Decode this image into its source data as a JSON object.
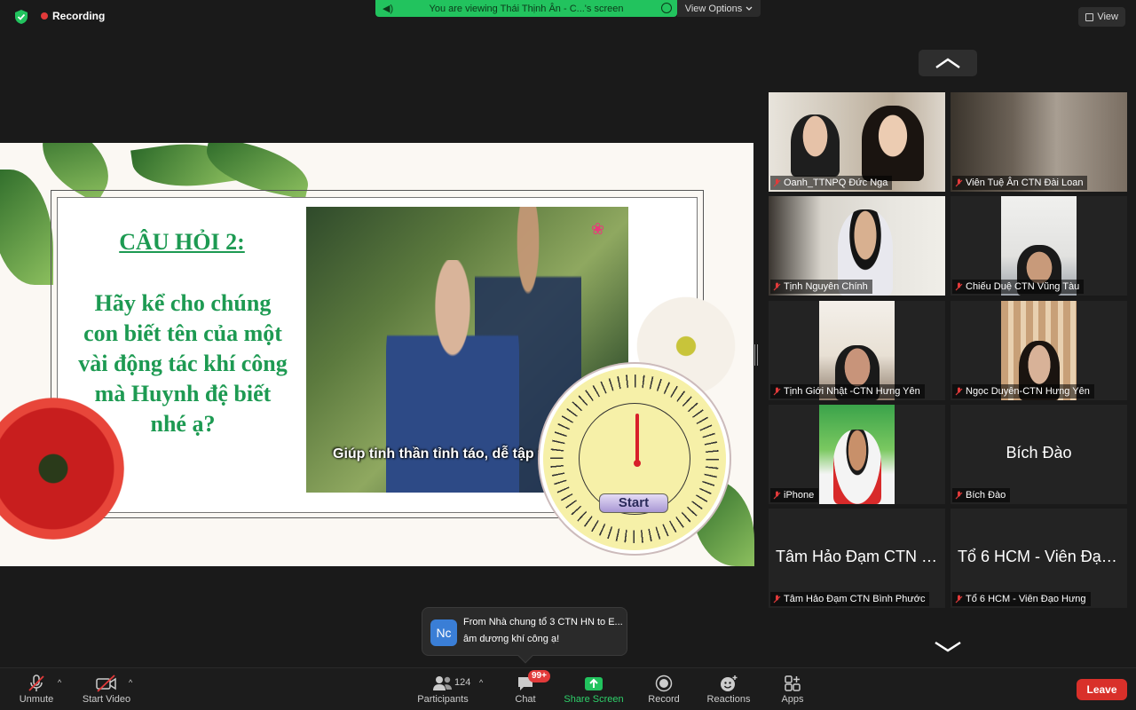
{
  "top": {
    "recording_label": "Recording",
    "viewing_banner": "You are viewing Thái Thịnh Ân - C...'s screen",
    "view_options_label": "View Options",
    "view_label": "View"
  },
  "slide": {
    "question_title": "CÂU HỎI 2:",
    "question_lines": [
      "Hãy kể cho chúng",
      "con biết tên của một",
      "vài động tác khí công",
      "mà Huynh đệ biết",
      "nhé ạ?"
    ],
    "video_subtitle": "Giúp tinh thần tỉnh táo, dễ tập trung, b",
    "start_button_label": "Start"
  },
  "gallery": {
    "tiles": [
      {
        "name": "Oanh_TTNPQ Đức Nga"
      },
      {
        "name": "Viên Tuệ Ân CTN Đài Loan"
      },
      {
        "name": "Tịnh Nguyên Chính"
      },
      {
        "name": "Chiếu Duệ CTN Vũng Tàu"
      },
      {
        "name": "Tịnh Giới Nhật -CTN Hưng Yên"
      },
      {
        "name": "Ngọc Duyên-CTN Hưng Yên"
      },
      {
        "name": "iPhone"
      },
      {
        "name": "Bích Đào",
        "display": "Bích Đào"
      },
      {
        "name": "Tâm Hảo Đạm CTN Bình Phước",
        "display": "Tâm Hảo Đạm CTN Bì..."
      },
      {
        "name": "Tổ 6 HCM - Viên Đạo Hưng",
        "display": "Tổ 6 HCM - Viên Đạo..."
      }
    ]
  },
  "chat_toast": {
    "avatar_initials": "Nc",
    "line1": "From Nhà chung tổ 3 CTN HN to E...",
    "line2": "âm dương khí công ạ!"
  },
  "toolbar": {
    "unmute_label": "Unmute",
    "start_video_label": "Start Video",
    "participants_label": "Participants",
    "participants_count": "124",
    "chat_label": "Chat",
    "chat_badge": "99+",
    "share_screen_label": "Share Screen",
    "record_label": "Record",
    "reactions_label": "Reactions",
    "apps_label": "Apps",
    "leave_label": "Leave"
  },
  "colors": {
    "share_green": "#22c35e",
    "question_green": "#1d9a52",
    "leave_red": "#d9302a",
    "badge_red": "#e23a3a"
  }
}
